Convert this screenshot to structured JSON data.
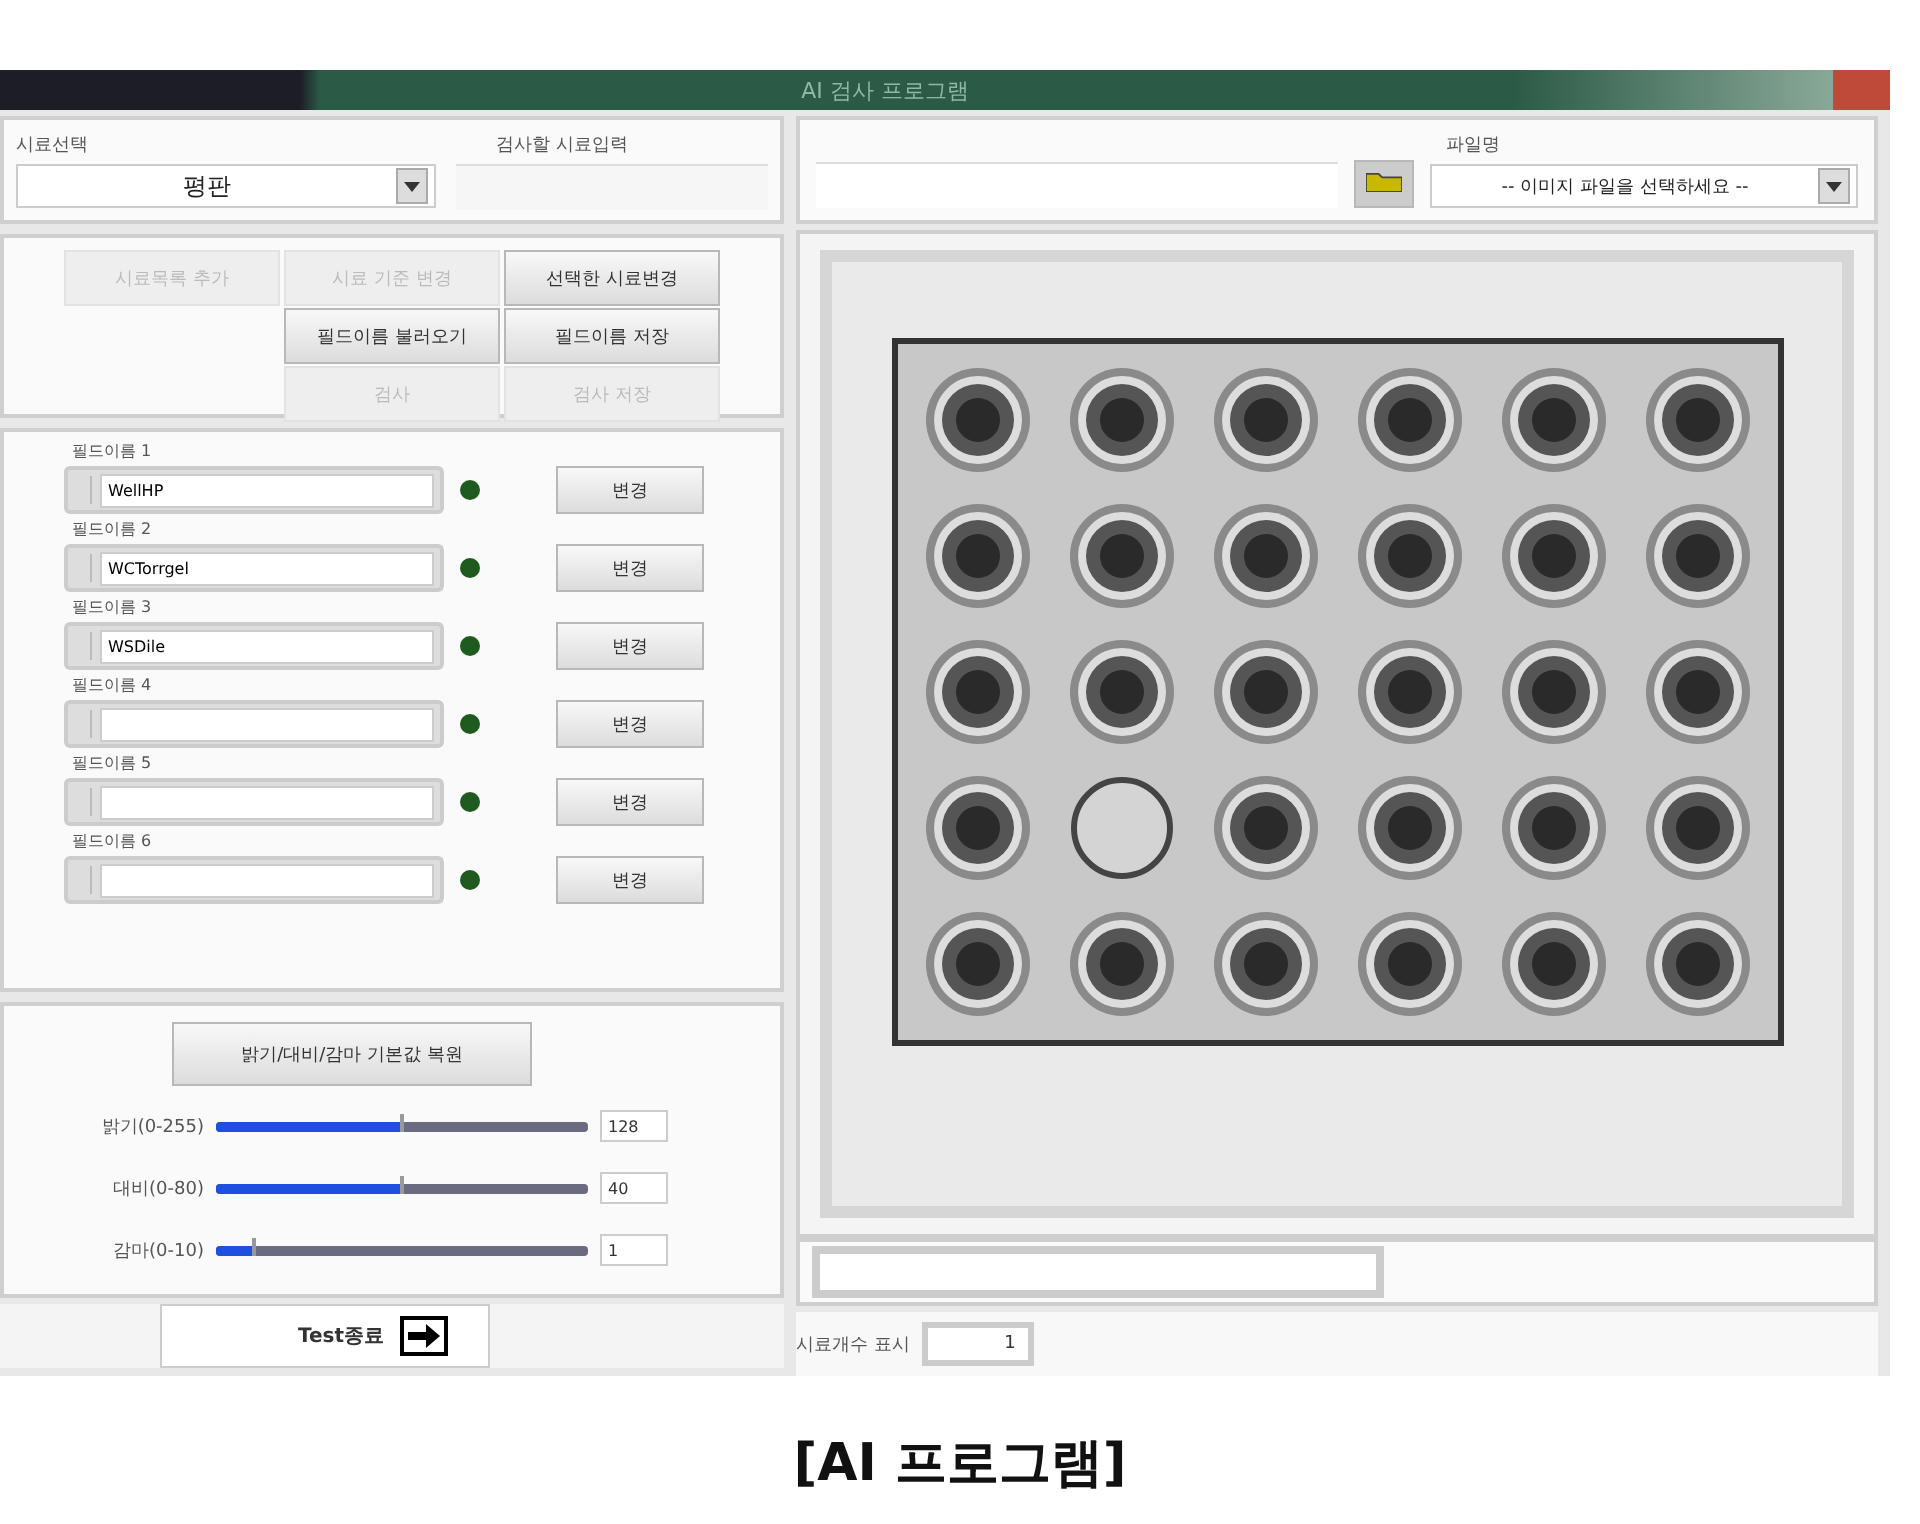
{
  "window": {
    "title": "AI 검사 프로그램"
  },
  "sample_select": {
    "label": "시료선택",
    "value": "평판"
  },
  "sample_input": {
    "label": "검사할 시료입력"
  },
  "button_rows": [
    {
      "buttons": [
        {
          "label": "시료목록 추가",
          "disabled": true
        },
        {
          "label": "시료 기준 변경",
          "disabled": true
        },
        {
          "label": "선택한 시료변경",
          "disabled": false
        }
      ]
    },
    {
      "buttons": [
        {
          "label": "필드이름 불러오기",
          "disabled": false
        },
        {
          "label": "필드이름 저장",
          "disabled": false
        }
      ]
    },
    {
      "buttons": [
        {
          "label": "검사",
          "disabled": true
        },
        {
          "label": "검사 저장",
          "disabled": true
        }
      ]
    }
  ],
  "fields": [
    {
      "label": "필드이름 1",
      "value": "WellHP",
      "button": "변경"
    },
    {
      "label": "필드이름 2",
      "value": "WCTorrgel",
      "button": "변경"
    },
    {
      "label": "필드이름 3",
      "value": "WSDile",
      "button": "변경"
    },
    {
      "label": "필드이름 4",
      "button": "변경"
    },
    {
      "label": "필드이름 5",
      "button": "변경"
    },
    {
      "label": "필드이름 6",
      "button": "변경"
    }
  ],
  "reset_button": "밝기/대비/감마 기본값 복원",
  "sliders": [
    {
      "label": "밝기(0-255)",
      "level": 0.5,
      "reading": "128"
    },
    {
      "label": "대비(0-80)",
      "level": 0.5,
      "reading": "40"
    },
    {
      "label": "감마(0-10)",
      "level": 0.1,
      "reading": "1"
    }
  ],
  "exit_button": "Test종료",
  "file": {
    "label": "파일명",
    "value": "-- 이미지 파일을 선택하세요 --"
  },
  "plate": {
    "rows": [
      [
        {
          "filled": true
        },
        {
          "filled": true
        },
        {
          "filled": true
        },
        {
          "filled": true
        },
        {
          "filled": true
        },
        {
          "filled": true
        }
      ],
      [
        {
          "filled": true
        },
        {
          "filled": true
        },
        {
          "filled": true
        },
        {
          "filled": true
        },
        {
          "filled": true
        },
        {
          "filled": true
        }
      ],
      [
        {
          "filled": true
        },
        {
          "filled": true
        },
        {
          "filled": true
        },
        {
          "filled": true
        },
        {
          "filled": true
        },
        {
          "filled": true
        }
      ],
      [
        {
          "filled": true
        },
        {
          "filled": false
        },
        {
          "filled": true
        },
        {
          "filled": true
        },
        {
          "filled": true
        },
        {
          "filled": true
        }
      ],
      [
        {
          "filled": true
        },
        {
          "filled": true
        },
        {
          "filled": true
        },
        {
          "filled": true
        },
        {
          "filled": true
        },
        {
          "filled": true
        }
      ]
    ]
  },
  "count": {
    "label": "시료개수 표시",
    "value": "1"
  },
  "caption": "[AI 프로그램]"
}
